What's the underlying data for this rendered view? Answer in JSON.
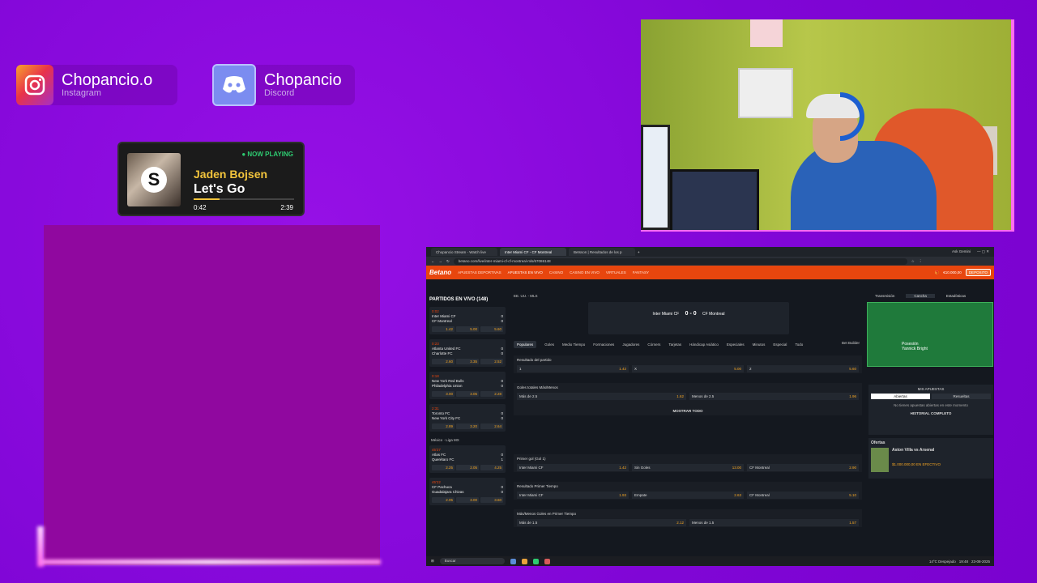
{
  "social": {
    "instagram": {
      "name": "Chopancio.o",
      "platform": "Instagram"
    },
    "discord": {
      "name": "Chopancio",
      "platform": "Discord"
    }
  },
  "now_playing": {
    "tag": "● NOW PLAYING",
    "artist": "Jaden Bojsen",
    "title": "Let's Go",
    "elapsed": "0:42",
    "duration": "2:39",
    "progress": 0.26,
    "album_letter": "S"
  },
  "browser": {
    "tabs": [
      "Chopancio Stream - Watch live",
      "Inter Miami CF - CF Montreal",
      "Betsson | Resultados de los p"
    ],
    "profile": "Ask Gemini",
    "url": "betano.com/live/inter-miami-cf-cf-montreal-mls/67086148",
    "site": {
      "logo": "Betano",
      "nav": [
        "APUESTAS DEPORTIVAS",
        "APUESTAS EN VIVO",
        "CASINO",
        "CASINO EN VIVO",
        "VIRTUALES",
        "FANTASY"
      ],
      "account": "€10.000,00",
      "deposit": "DEPOSITO"
    },
    "left": {
      "header": "PARTIDOS EN VIVO (148)",
      "league_mx": "México · Liga MX",
      "matches": [
        {
          "time": "0:02",
          "home": "Inter Miami CF",
          "away": "CF Montreal",
          "hs": "0",
          "as": "0",
          "o1": "1.42",
          "ox": "5.00",
          "o2": "5.60"
        },
        {
          "time": "0:23",
          "home": "Atlanta United FC",
          "away": "Charlotte FC",
          "hs": "0",
          "as": "0",
          "o1": "2.60",
          "ox": "3.35",
          "o2": "2.52"
        },
        {
          "time": "0:18",
          "home": "New York Red Bulls",
          "away": "Philadelphia Union",
          "hs": "0",
          "as": "0",
          "o1": "3.00",
          "ox": "3.05",
          "o2": "2.28"
        },
        {
          "time": "2:31",
          "home": "Toronto FC",
          "away": "New York City FC",
          "hs": "0",
          "as": "0",
          "o1": "2.89",
          "ox": "3.20",
          "o2": "2.64"
        },
        {
          "time": "45'27",
          "home": "Atlas FC",
          "away": "Querétaro FC",
          "hs": "0",
          "as": "1",
          "o1": "2.25",
          "ox": "2.05",
          "o2": "4.25"
        },
        {
          "time": "45'22",
          "home": "CF Pachuca",
          "away": "Guadalajara Chivas",
          "hs": "0",
          "as": "0",
          "o1": "2.05",
          "ox": "3.00",
          "o2": "3.60"
        }
      ]
    },
    "center": {
      "league": "EE. UU. - MLS",
      "home": "Inter Miami CF",
      "away": "CF Montreal",
      "score": "0 - 0",
      "subtabs": [
        "Populares",
        "Goles",
        "Medio Tiempo",
        "Formaciones",
        "Jugadores",
        "Córners",
        "Tarjetas",
        "Hándicap Asiático",
        "Especiales",
        "Minutos",
        "Especial",
        "Todo"
      ],
      "bet_builder": "Bet Builder",
      "markets": [
        {
          "title": "Resultado del partido",
          "opts": [
            [
              "1",
              "1.42"
            ],
            [
              "X",
              "5.00"
            ],
            [
              "2",
              "5.60"
            ]
          ]
        },
        {
          "title": "Goles totales Más/Menos",
          "opts": [
            [
              "Más de 2.5",
              "1.62"
            ],
            [
              "Menos de 2.5",
              "1.96"
            ]
          ]
        },
        {
          "title": "Primer gol (Gol 1)",
          "opts": [
            [
              "Inter Miami CF",
              "1.42"
            ],
            [
              "Sin Goles",
              "13.00"
            ],
            [
              "CF Montreal",
              "2.90"
            ]
          ]
        },
        {
          "title": "Resultado Primer Tiempo",
          "opts": [
            [
              "Inter Miami CF",
              "1.93"
            ],
            [
              "Empate",
              "2.63"
            ],
            [
              "CF Montreal",
              "5.10"
            ]
          ]
        },
        {
          "title": "Más/Menos Goles en Primer Tiempo",
          "opts": [
            [
              "Más de 1.5",
              "2.12"
            ],
            [
              "Menos de 1.5",
              "1.57"
            ]
          ]
        }
      ],
      "show_all": "MOSTRAR TODO"
    },
    "right": {
      "tabs": [
        "Transmisión",
        "Cancha",
        "Estadísticas"
      ],
      "possession": "Posesión",
      "player": "Yannick Bright",
      "my_bets": "MIS APUESTAS",
      "toggle": [
        "Abiertas",
        "Resueltas"
      ],
      "no_bets": "No tienes apuestas abiertas en este momento",
      "history": "HISTORIAL COMPLETO",
      "offers_title": "Ofertas",
      "offer_match": "Aston Villa vs Arsenal",
      "offer_prize": "$1.000.000,00 EN EFECTIVO"
    },
    "taskbar": {
      "search": "Buscar",
      "weather": "14°C Despejado",
      "time": "19:48",
      "date": "23-08-2025"
    }
  },
  "colors": {
    "accent": "#e8460e",
    "odds": "#f5a623",
    "bg": "#8a06d8"
  }
}
